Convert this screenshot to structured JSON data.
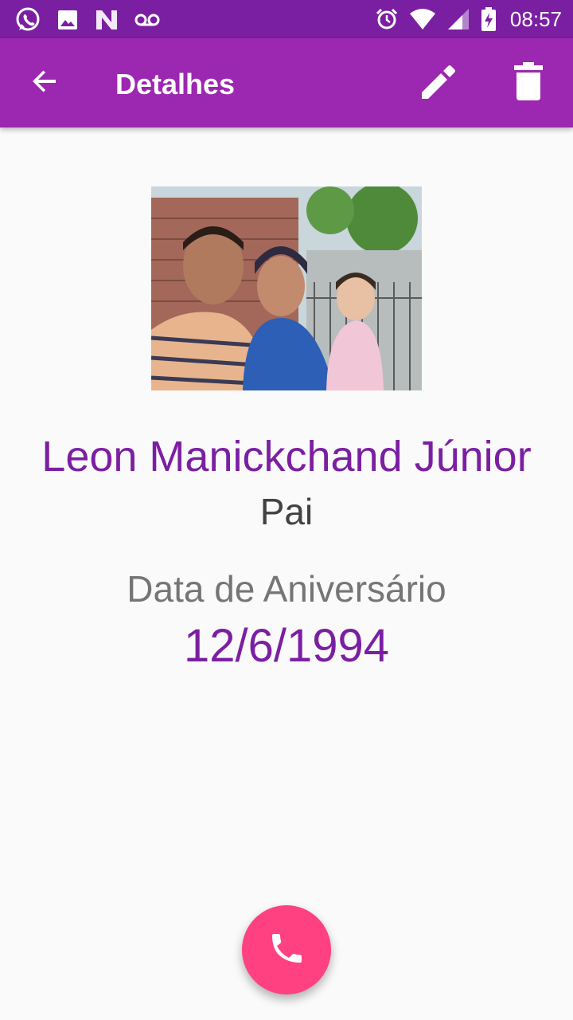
{
  "status_bar": {
    "time": "08:57",
    "left_icons": [
      "whatsapp-icon",
      "image-icon",
      "n-logo-icon",
      "voicemail-icon"
    ],
    "right_icons": [
      "alarm-icon",
      "wifi-icon",
      "signal-icon",
      "battery-charging-icon"
    ]
  },
  "app_bar": {
    "title": "Detalhes",
    "back_icon": "arrow-back-icon",
    "edit_icon": "pencil-icon",
    "delete_icon": "trash-icon"
  },
  "contact": {
    "photo_description": "family photo",
    "name": "Leon Manickchand Júnior",
    "relation": "Pai",
    "birthday_label": "Data de Aniversário",
    "birthday_value": "12/6/1994"
  },
  "fab": {
    "icon": "phone-icon"
  },
  "colors": {
    "status_bar": "#7b1fa2",
    "app_bar": "#9c27b0",
    "accent": "#ff4081",
    "primary_text": "#7b1fa2",
    "background": "#fafafa"
  }
}
